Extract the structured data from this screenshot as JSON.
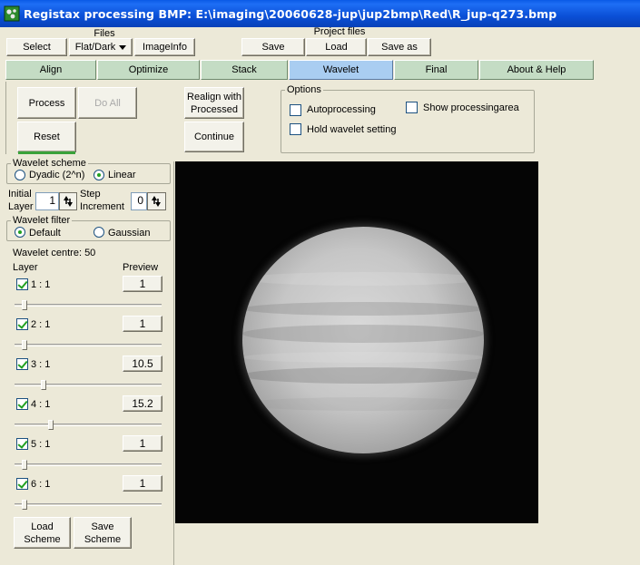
{
  "window": {
    "title": "Registax processing  BMP: E:\\imaging\\20060628-jup\\jup2bmp\\Red\\R_jup-q273.bmp"
  },
  "files": {
    "label": "Files",
    "select": "Select",
    "flatdark": "Flat/Dark",
    "imageinfo": "ImageInfo"
  },
  "project": {
    "label": "Project files",
    "save": "Save",
    "load": "Load",
    "saveas": "Save as"
  },
  "tabs": [
    "Align",
    "Optimize",
    "Stack",
    "Wavelet",
    "Final",
    "About & Help"
  ],
  "active_tab": "Wavelet",
  "actions": {
    "process": "Process",
    "doall": "Do All",
    "reset": "Reset",
    "realign": "Realign with Processed",
    "continue": "Continue"
  },
  "options": {
    "label": "Options",
    "autoprocessing": {
      "label": "Autoprocessing",
      "checked": false
    },
    "show_area": {
      "label": "Show processingarea",
      "checked": false
    },
    "hold_wavelet": {
      "label": "Hold wavelet setting",
      "checked": false
    }
  },
  "scheme": {
    "label": "Wavelet scheme",
    "dyadic": "Dyadic (2^n)",
    "linear": "Linear",
    "selected": "Linear"
  },
  "initial_layer": {
    "label1": "Initial",
    "label2": "Layer",
    "value": "1"
  },
  "step_increment": {
    "label1": "Step",
    "label2": "Increment",
    "value": "0"
  },
  "filter": {
    "label": "Wavelet filter",
    "default": "Default",
    "gaussian": "Gaussian",
    "selected": "Default"
  },
  "wavelet_centre": "Wavelet centre: 50",
  "layer_header": "Layer",
  "preview_header": "Preview",
  "layers": [
    {
      "label": "1 : 1",
      "checked": true,
      "preview": "1",
      "level": 0.05
    },
    {
      "label": "2 : 1",
      "checked": true,
      "preview": "1",
      "level": 0.05
    },
    {
      "label": "3 : 1",
      "checked": true,
      "preview": "10.5",
      "level": 0.18
    },
    {
      "label": "4 : 1",
      "checked": true,
      "preview": "15.2",
      "level": 0.23
    },
    {
      "label": "5 : 1",
      "checked": true,
      "preview": "1",
      "level": 0.05
    },
    {
      "label": "6 : 1",
      "checked": true,
      "preview": "1",
      "level": 0.05
    }
  ],
  "scheme_buttons": {
    "load": "Load Scheme",
    "save": "Save Scheme"
  }
}
